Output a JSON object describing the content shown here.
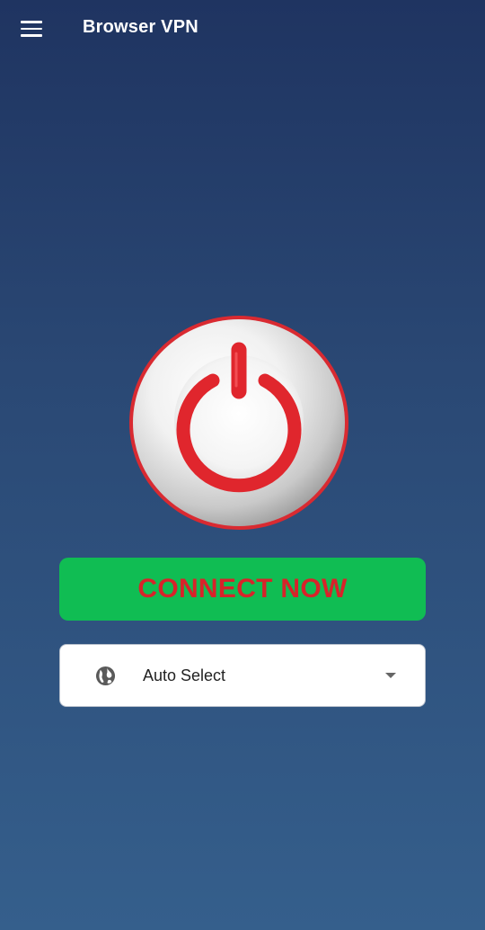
{
  "app_bar": {
    "title": "Browser VPN",
    "menu_icon": "hamburger-menu-icon"
  },
  "power_button": {
    "icon": "power-icon",
    "accent_color": "#e0262d"
  },
  "connect_button": {
    "label": "CONNECT NOW",
    "background_color": "#10bd53",
    "text_color": "#d8232a"
  },
  "server_selector": {
    "icon": "globe-icon",
    "selected": "Auto Select",
    "dropdown_icon": "caret-down-icon"
  }
}
